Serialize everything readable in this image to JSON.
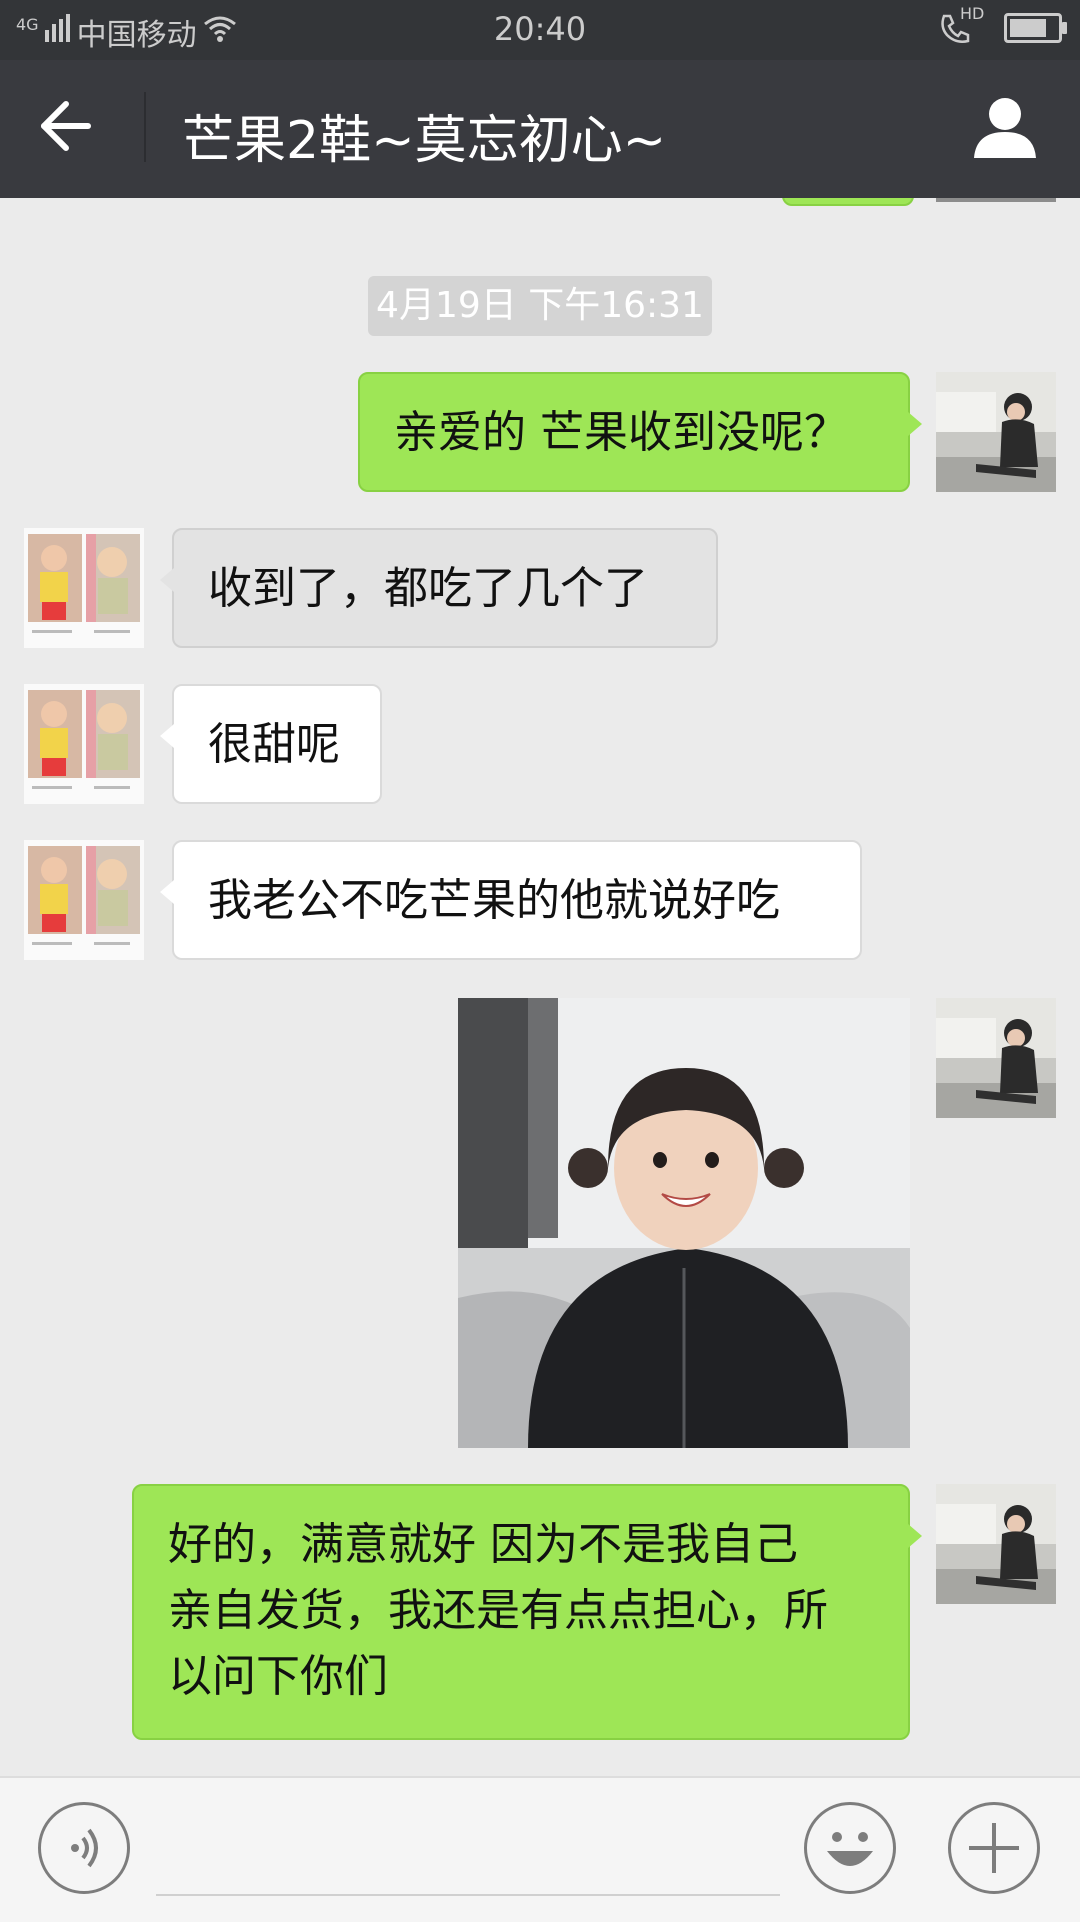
{
  "status_bar": {
    "network": "4G",
    "carrier": "中国移动",
    "time": "20:40",
    "call_badge": "HD",
    "battery_level": 0.78
  },
  "header": {
    "title": "芒果2鞋~莫忘初心~",
    "back_icon": "arrow-left-icon",
    "profile_icon": "person-icon"
  },
  "chat": {
    "timestamp": "4月19日 下午16:31",
    "messages": [
      {
        "side": "right",
        "type": "text",
        "lines": [
          "亲爱的  芒果收到没呢？"
        ]
      },
      {
        "side": "left",
        "type": "text",
        "lines": [
          "收到了，都吃了几个了"
        ]
      },
      {
        "side": "left",
        "type": "text",
        "lines": [
          "很甜呢"
        ]
      },
      {
        "side": "left",
        "type": "text",
        "lines": [
          "我老公不吃芒果的他就说好吃"
        ]
      },
      {
        "side": "right",
        "type": "image"
      },
      {
        "side": "right",
        "type": "text",
        "lines": [
          "好的，满意就好   因为不是我自己",
          "亲自发货，我还是有点点担心，所",
          "以问下你们"
        ]
      }
    ]
  },
  "input_bar": {
    "voice_icon": "voice-icon",
    "emoji_icon": "emoji-icon",
    "plus_icon": "plus-icon",
    "text_value": ""
  },
  "colors": {
    "status_bar": "#333538",
    "nav_bar": "#393a3f",
    "chat_bg": "#ebebeb",
    "bubble_sent": "#9ee656",
    "bubble_received": "#ffffff",
    "timestamp_bg": "#d4d4d4"
  }
}
